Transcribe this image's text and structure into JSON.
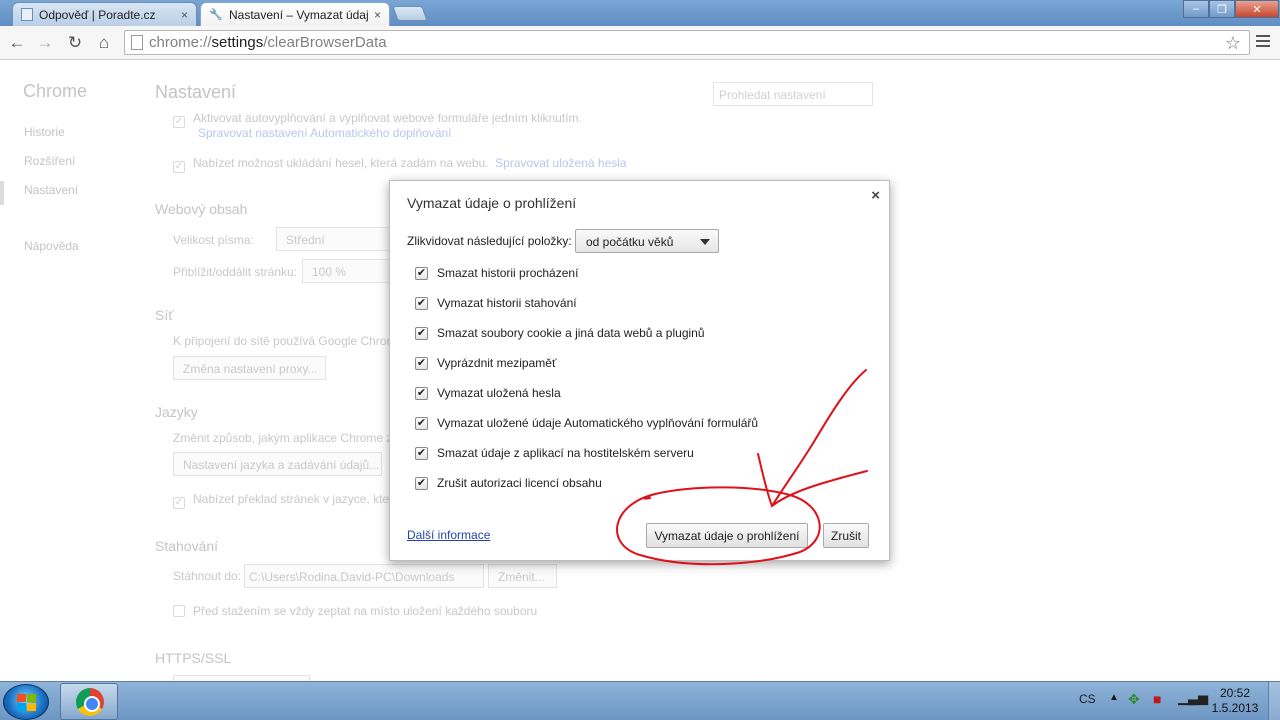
{
  "tabs": [
    {
      "title": "Odpověď | Poradte.cz",
      "icon": "page-icon"
    },
    {
      "title": "Nastavení – Vymazat údaj",
      "icon": "wrench-icon"
    }
  ],
  "window_controls": {
    "minimize": "–",
    "maximize": "❐",
    "close": "✕"
  },
  "omnibox": {
    "scheme": "chrome://",
    "host": "settings",
    "path": "/clearBrowserData"
  },
  "sidebar": {
    "title": "Chrome",
    "items": [
      {
        "label": "Historie"
      },
      {
        "label": "Rozšíření"
      },
      {
        "label": "Nastavení"
      },
      {
        "label": "Nápověda"
      }
    ]
  },
  "settings": {
    "title": "Nastavení",
    "search_placeholder": "Prohledat nastavení",
    "autofill_text": "Aktivovat autovyplňování a vyplňovat webové formuláře jedním kliknutím.",
    "autofill_link": "Spravovat nastavení Automatického doplňování",
    "passwords_text": "Nabízet možnost ukládání hesel, která zadám na webu.",
    "passwords_link": "Spravovat uložená hesla",
    "web_content_heading": "Webový obsah",
    "font_size_label": "Velikost písma:",
    "font_size_value": "Střední",
    "zoom_label": "Přiblížit/oddálit stránku:",
    "zoom_value": "100 %",
    "network_heading": "Síť",
    "network_text": "K připojení do sítě používá Google Chrom",
    "proxy_button": "Změna nastavení proxy...",
    "languages_heading": "Jazyky",
    "languages_text": "Změnit způsob, jakým aplikace Chrome z",
    "language_button": "Nastavení jazyka a zadávání údajů...",
    "translate_text": "Nabízet překlad stránek v jazyce, kterc",
    "downloads_heading": "Stahování",
    "download_to_label": "Stáhnout do:",
    "download_path": "C:\\Users\\Rodina.David-PC\\Downloads",
    "change_button": "Změnit...",
    "ask_text": "Před stažením se vždy zeptat na místo uložení každého souboru",
    "https_heading": "HTTPS/SSL"
  },
  "dialog": {
    "title": "Vymazat údaje o prohlížení",
    "close": "×",
    "obliterate_label": "Zlikvidovat následující položky:",
    "period_value": "od počátku věků",
    "options": [
      {
        "label": "Smazat historii procházení",
        "checked": true
      },
      {
        "label": "Vymazat historii stahování",
        "checked": true
      },
      {
        "label": "Smazat soubory cookie a jiná data webů a pluginů",
        "checked": true
      },
      {
        "label": "Vyprázdnit mezipaměť",
        "checked": true
      },
      {
        "label": "Vymazat uložená hesla",
        "checked": true
      },
      {
        "label": "Vymazat uložené údaje Automatického vyplňování formulářů",
        "checked": true
      },
      {
        "label": "Smazat údaje z aplikací na hostitelském serveru",
        "checked": true
      },
      {
        "label": "Zrušit autorizaci licencí obsahu",
        "checked": true
      }
    ],
    "more_info": "Další informace",
    "clear_button": "Vymazat údaje o prohlížení",
    "cancel_button": "Zrušit",
    "annotation_color": "#e0101a"
  },
  "taskbar": {
    "language": "CS",
    "time": "20:52",
    "date": "1.5.2013"
  }
}
